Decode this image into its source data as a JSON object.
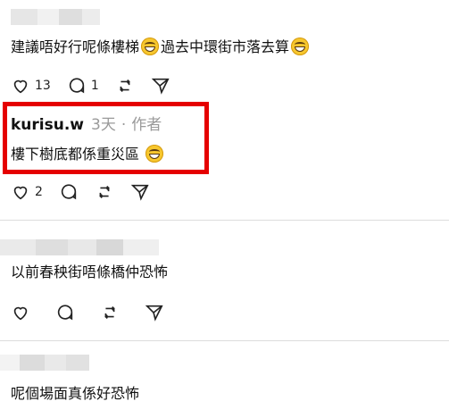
{
  "comments": [
    {
      "text_part1": "建議唔好行呢條樓梯",
      "text_part2": "過去中環街市落去算",
      "likes": "13",
      "replies": "1"
    },
    {
      "username": "kurisu.w",
      "time": "3天",
      "separator": "·",
      "role": "作者",
      "text": "樓下樹底都係重災區",
      "likes": "2"
    },
    {
      "text": "以前春秧街唔條橋仲恐怖"
    },
    {
      "text": "呢個場面真係好恐怖"
    }
  ],
  "colors": {
    "highlight": "#e50000",
    "divider": "#dcdcdc",
    "meta": "#9a9a9a"
  }
}
